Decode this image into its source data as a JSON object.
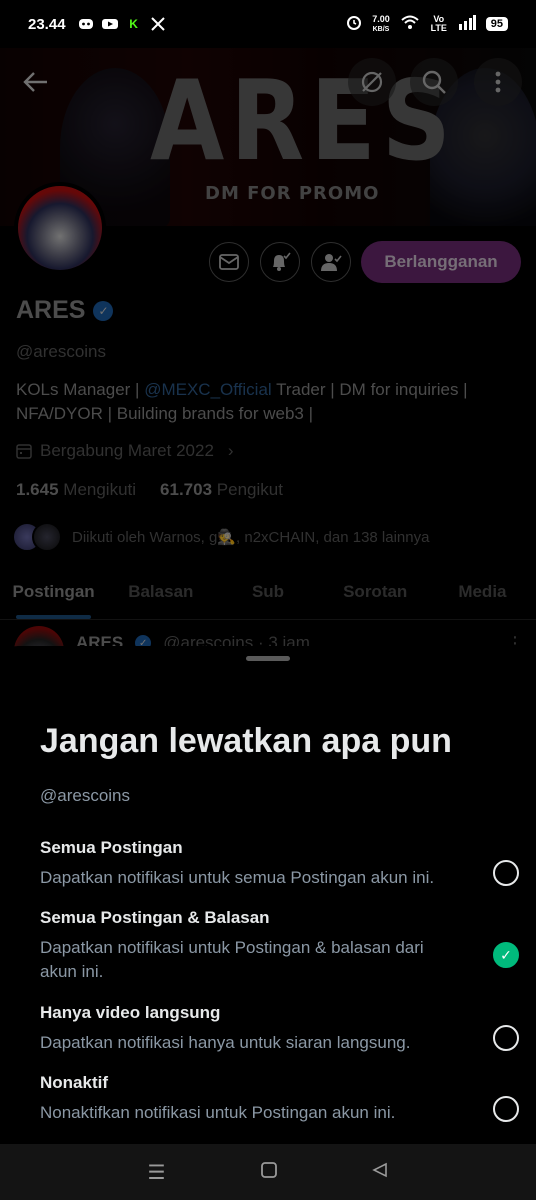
{
  "status_bar": {
    "time": "23.44",
    "speed_value": "7.00",
    "speed_unit": "KB/S",
    "network": "Vo LTE",
    "battery": "95"
  },
  "banner": {
    "title": "ARES",
    "subtitle": "DM FOR PROMO"
  },
  "profile": {
    "name": "ARES",
    "handle": "@arescoins",
    "bio_prefix": "KOLs Manager | ",
    "bio_mention": "@MEXC_Official",
    "bio_suffix": " Trader | DM for inquiries | NFA/DYOR | Building brands for web3 |",
    "joined": "Bergabung Maret 2022",
    "following_count": "1.645",
    "following_label": "Mengikuti",
    "followers_count": "61.703",
    "followers_label": "Pengikut",
    "followed_by": "Diikuti oleh Warnos, g🕵️, n2xCHAIN, dan 138 lainnya",
    "subscribe_label": "Berlangganan"
  },
  "tabs": [
    {
      "label": "Postingan"
    },
    {
      "label": "Balasan"
    },
    {
      "label": "Sub"
    },
    {
      "label": "Sorotan"
    },
    {
      "label": "Media"
    }
  ],
  "post_peek": {
    "name": "ARES",
    "handle_time": "@arescoins · 3 jam"
  },
  "sheet": {
    "title": "Jangan lewatkan apa pun",
    "handle": "@arescoins",
    "options": [
      {
        "title": "Semua Postingan",
        "desc": "Dapatkan notifikasi untuk semua Postingan akun ini.",
        "selected": false
      },
      {
        "title": "Semua Postingan & Balasan",
        "desc": "Dapatkan notifikasi untuk Postingan & balasan dari akun ini.",
        "selected": true
      },
      {
        "title": "Hanya video langsung",
        "desc": "Dapatkan notifikasi hanya untuk siaran langsung.",
        "selected": false
      },
      {
        "title": "Nonaktif",
        "desc": "Nonaktifkan notifikasi untuk Postingan akun ini.",
        "selected": false
      }
    ]
  },
  "colors": {
    "accent_green": "#00ba7c",
    "subscribe_purple": "#6e2b73",
    "link_blue": "#1d9bf0"
  }
}
